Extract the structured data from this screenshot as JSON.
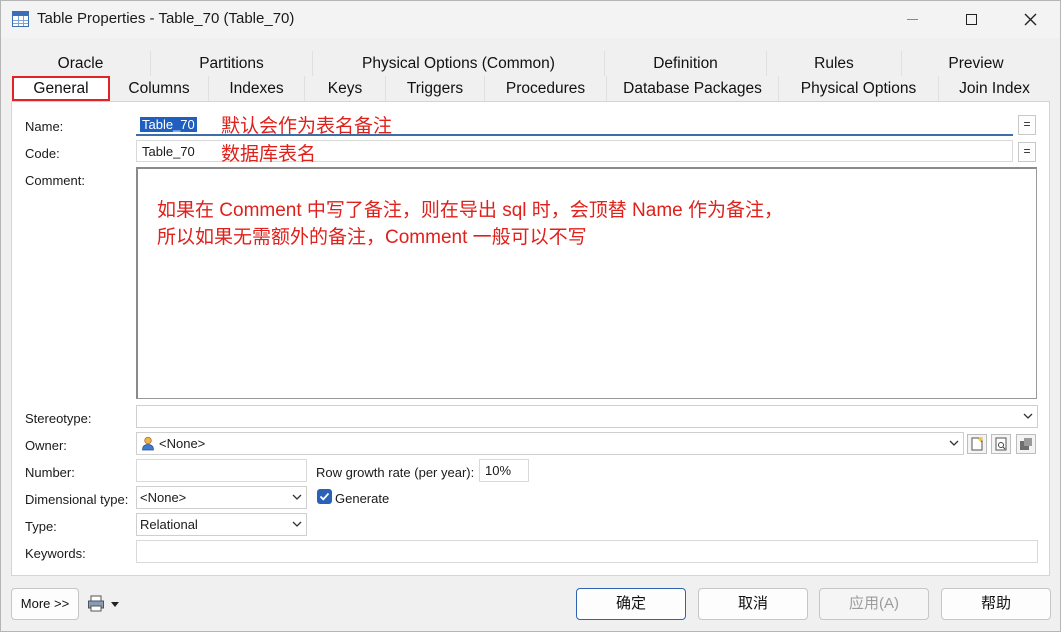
{
  "window": {
    "title": "Table Properties - Table_70 (Table_70)"
  },
  "tabs_row1": [
    "Oracle",
    "Partitions",
    "Physical Options (Common)",
    "Definition",
    "Rules",
    "Preview"
  ],
  "tabs_row2": [
    "General",
    "Columns",
    "Indexes",
    "Keys",
    "Triggers",
    "Procedures",
    "Database Packages",
    "Physical Options",
    "Join Index"
  ],
  "form": {
    "name_label": "Name:",
    "name_value": "Table_70",
    "name_annotation": "默认会作为表名备注",
    "code_label": "Code:",
    "code_value": "Table_70",
    "code_annotation": "数据库表名",
    "equals_label": "=",
    "comment_label": "Comment:",
    "comment_annotation_line1": "如果在 Comment 中写了备注，则在导出 sql 时，会顶替 Name 作为备注，",
    "comment_annotation_line2": "所以如果无需额外的备注，Comment 一般可以不写",
    "stereotype_label": "Stereotype:",
    "stereotype_value": "",
    "owner_label": "Owner:",
    "owner_value": "<None>",
    "number_label": "Number:",
    "number_value": "",
    "row_growth_label": "Row growth rate (per year):",
    "row_growth_value": "10%",
    "dimensional_type_label": "Dimensional type:",
    "dimensional_type_value": "<None>",
    "generate_label": "Generate",
    "generate_checked": true,
    "type_label": "Type:",
    "type_value": "Relational",
    "keywords_label": "Keywords:",
    "keywords_value": ""
  },
  "footer": {
    "more_label": "More >>",
    "ok_label": "确定",
    "cancel_label": "取消",
    "apply_label": "应用(A)",
    "help_label": "帮助"
  },
  "colors": {
    "accent": "#2f64b4",
    "annotation": "#e0201b",
    "active_tab_border": "#e02424"
  },
  "icons": [
    "table-icon",
    "minimize-icon",
    "maximize-icon",
    "close-icon",
    "user-icon",
    "new-object-icon",
    "properties-icon",
    "select-icon",
    "print-icon",
    "dropdown-arrow-icon"
  ]
}
